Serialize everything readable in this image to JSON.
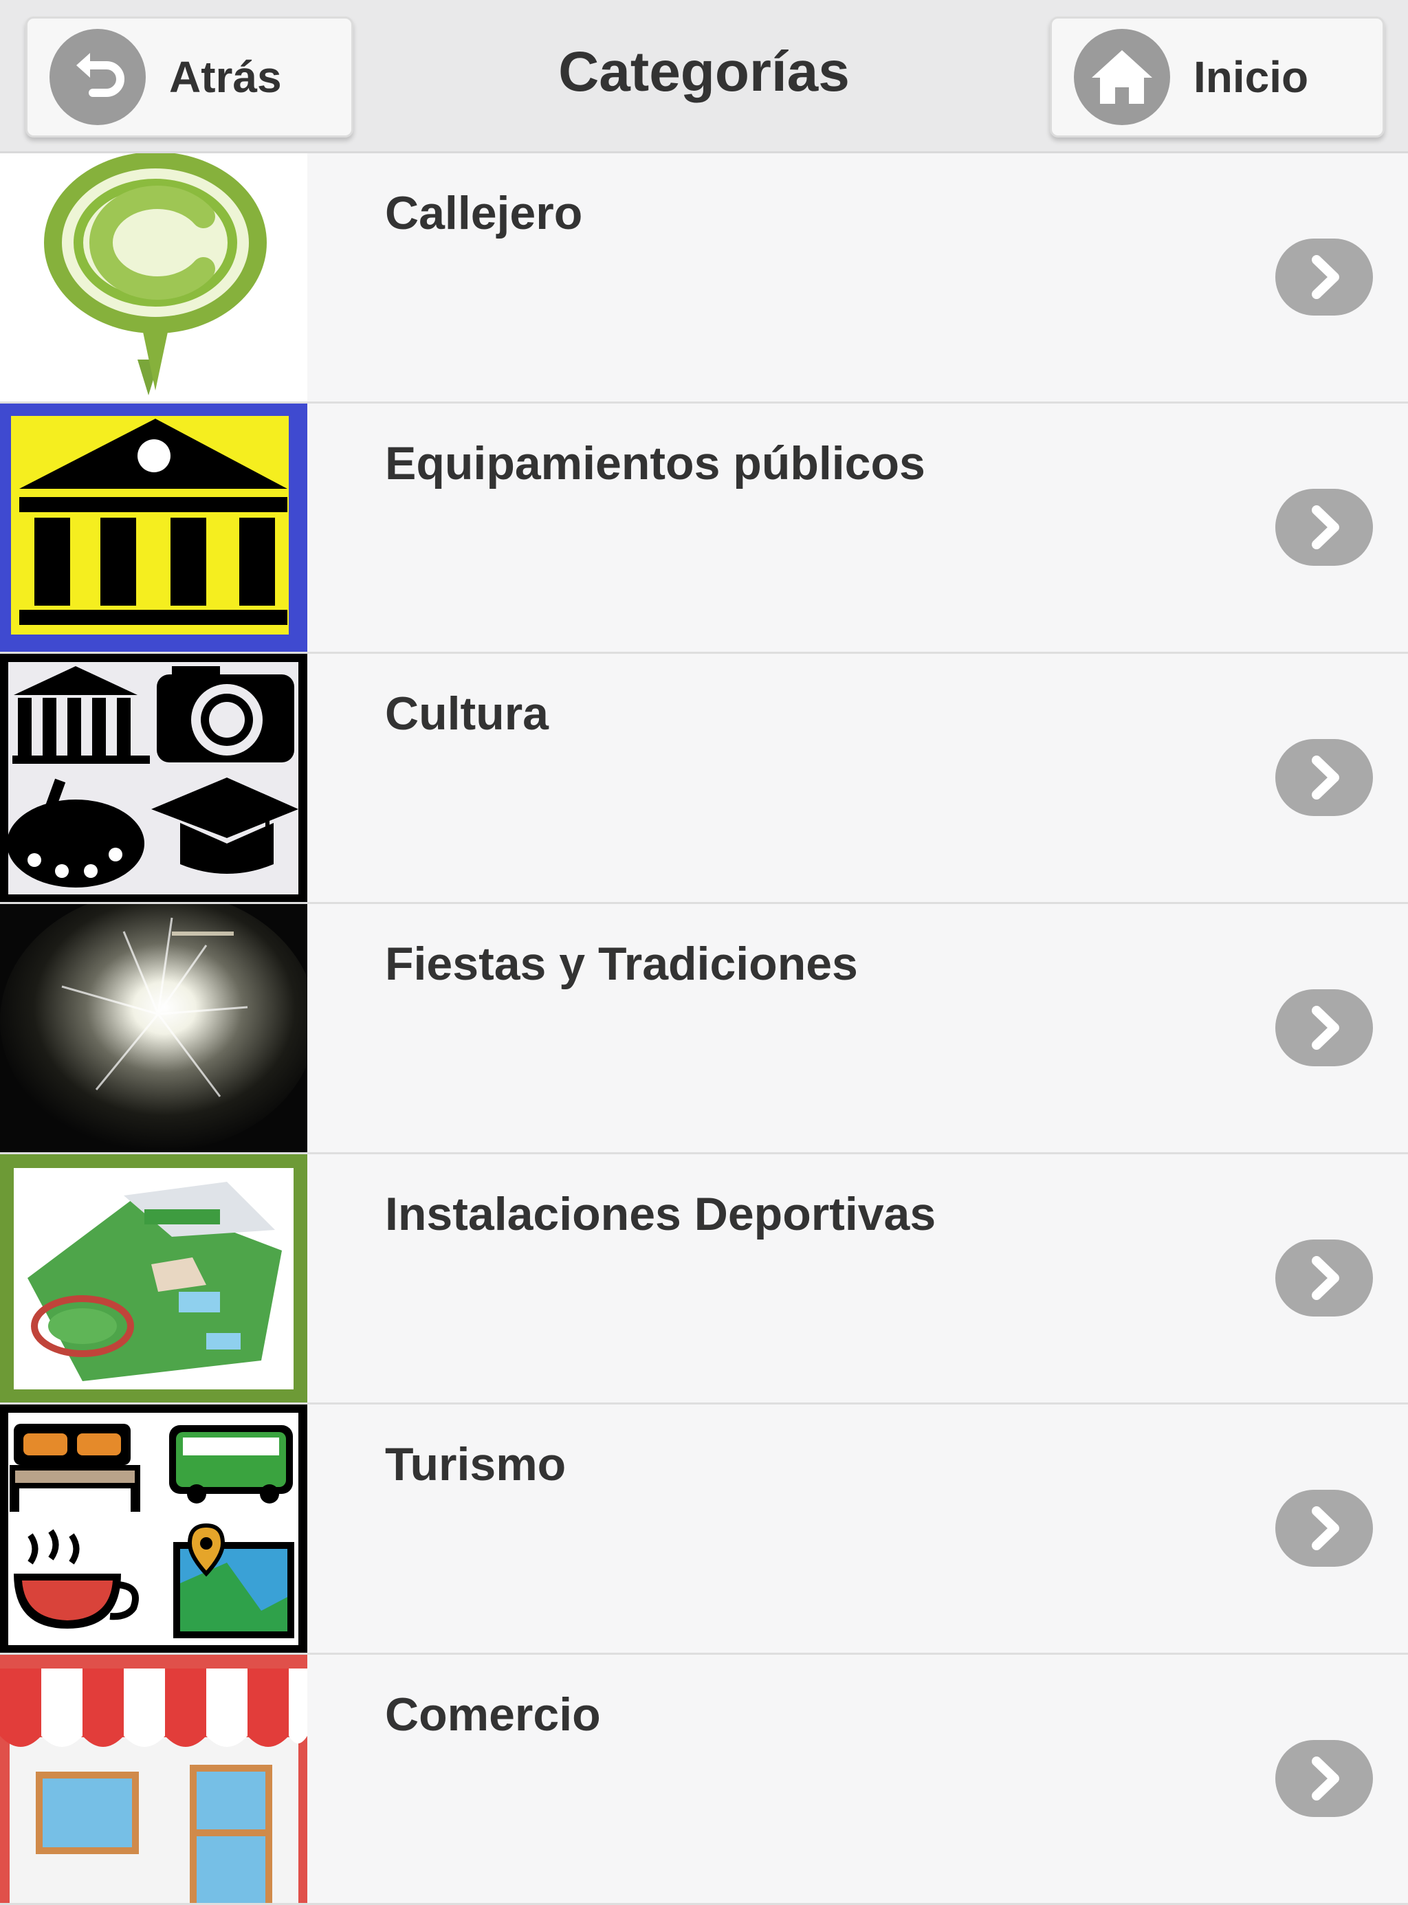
{
  "header": {
    "title": "Categorías",
    "back_label": "Atrás",
    "home_label": "Inicio",
    "back_icon": "undo-arrow-icon",
    "home_icon": "house-icon"
  },
  "categories": [
    {
      "label": "Callejero",
      "icon": "map-pin-c-icon"
    },
    {
      "label": "Equipamientos públicos",
      "icon": "public-building-icon"
    },
    {
      "label": "Cultura",
      "icon": "culture-collage-icon"
    },
    {
      "label": "Fiestas y Tradiciones",
      "icon": "fireworks-photo"
    },
    {
      "label": "Instalaciones Deportivas",
      "icon": "sports-facilities-map-icon"
    },
    {
      "label": "Turismo",
      "icon": "tourism-collage-icon"
    },
    {
      "label": "Comercio",
      "icon": "shop-storefront-icon"
    }
  ],
  "colors": {
    "header_bg": "#e9e9ea",
    "list_bg": "#f6f6f7",
    "chevron_bg": "#a9a9a9",
    "text": "#333333"
  }
}
